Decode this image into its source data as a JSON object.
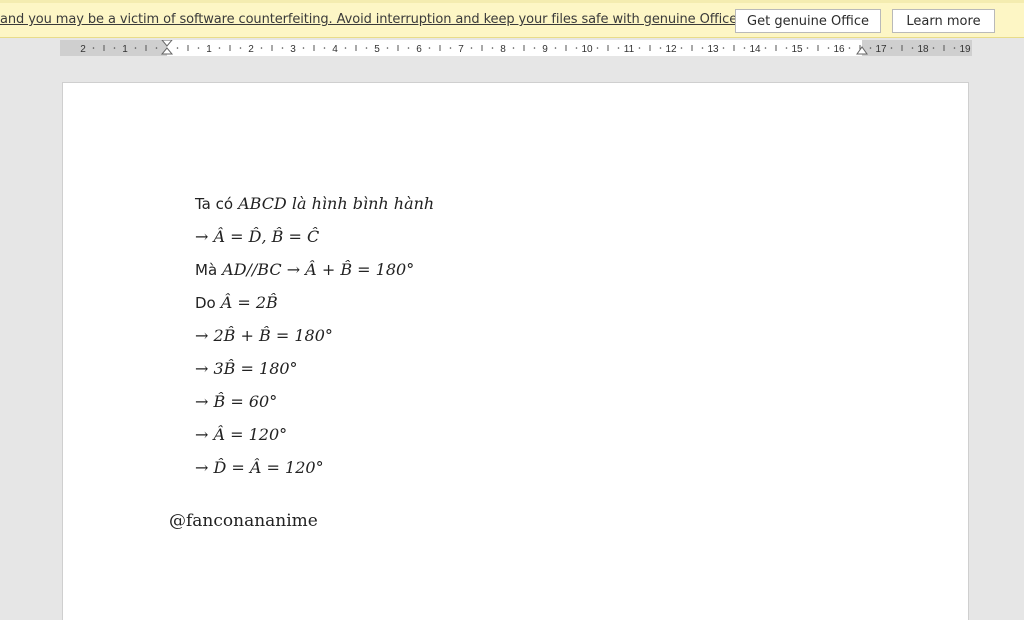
{
  "notice": {
    "text": "and you may be a victim of software counterfeiting. Avoid interruption and keep your files safe with genuine Office today.",
    "get_genuine_label": "Get genuine Office",
    "learn_more_label": "Learn more"
  },
  "ruler": {
    "labels": [
      "2",
      "1",
      "1",
      "2",
      "3",
      "4",
      "5",
      "6",
      "7",
      "8",
      "9",
      "10",
      "11",
      "12",
      "13",
      "14",
      "15",
      "16",
      "17",
      "18",
      "19"
    ]
  },
  "document": {
    "lines": [
      {
        "prefix": "Ta có",
        "math": "ABCD là hình bình hành"
      },
      {
        "prefix": "",
        "math": "→ Â = D̂, B̂ = Ĉ"
      },
      {
        "prefix": "Mà",
        "math": "AD//BC → Â + B̂ = 180°"
      },
      {
        "prefix": "Do",
        "math": "Â = 2B̂"
      },
      {
        "prefix": "",
        "math": "→ 2B̂ + B̂ = 180°"
      },
      {
        "prefix": "",
        "math": "→ 3B̂ = 180°"
      },
      {
        "prefix": "",
        "math": "→ B̂ = 60°"
      },
      {
        "prefix": "",
        "math": "→ Â = 120°"
      },
      {
        "prefix": "",
        "math": "→ D̂ = Â = 120°"
      }
    ],
    "signature": "@fanconananime"
  },
  "colors": {
    "notice_bg": "#fdf6c5",
    "workspace_bg": "#e6e6e6",
    "page_bg": "#ffffff"
  }
}
